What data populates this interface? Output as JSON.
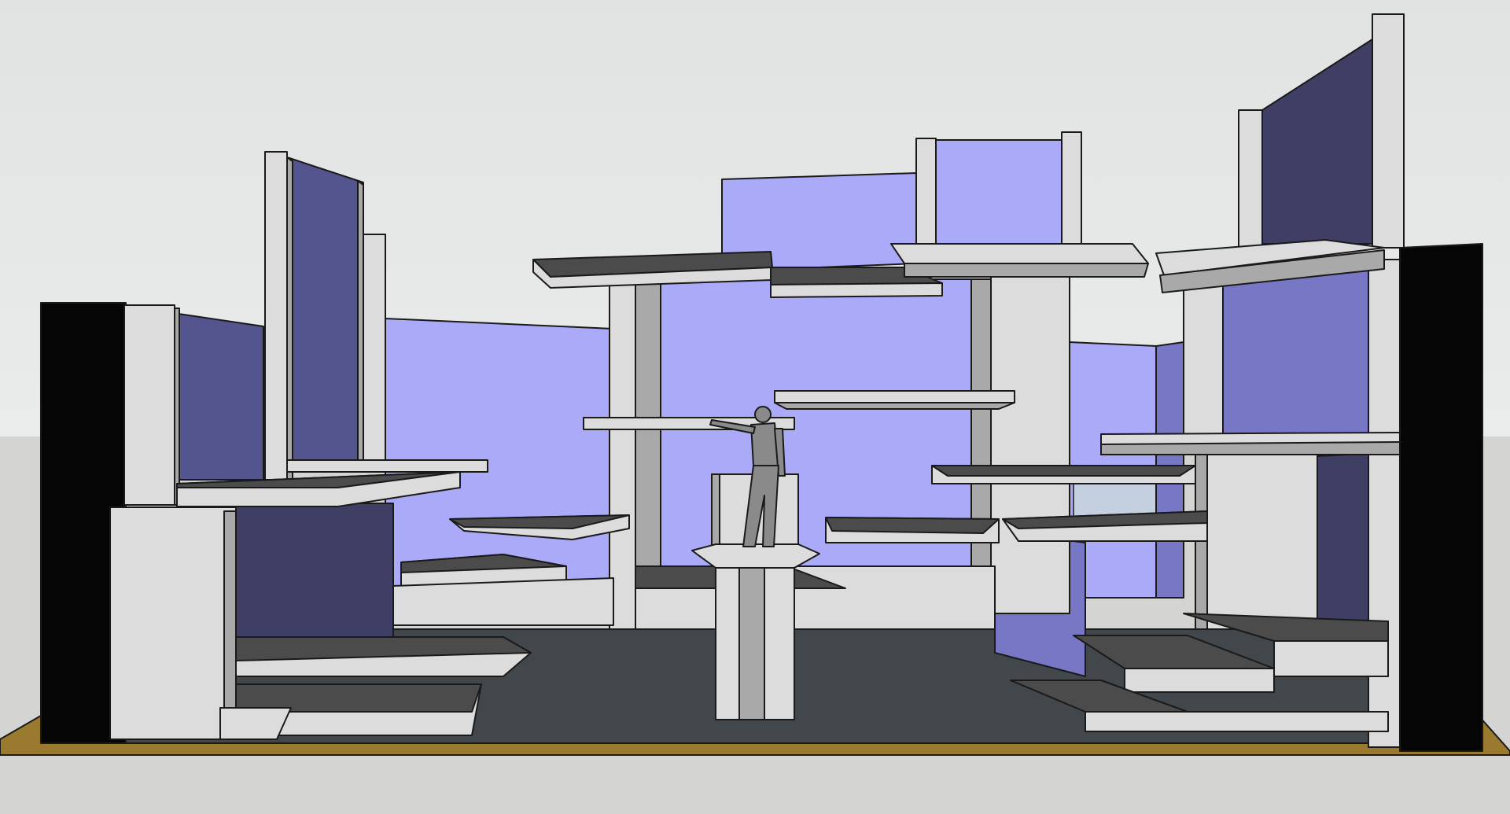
{
  "scene": {
    "kind": "3d-model-render",
    "colors": {
      "sky_top": "#e1e3e3",
      "sky_bottom": "#eaecec",
      "ground": "#d4d5d2",
      "stage_floor": "#42474b",
      "stage_edge": "#9a7a2e",
      "concrete": "#dcdcdc",
      "concrete_shadow": "#a9a9a9",
      "concrete_dark": "#8f8f8f",
      "slab_top": "#4b4b4b",
      "outline": "#1a1a1a",
      "wall_light": "#aaaaf8",
      "wall_mid": "#7777c6",
      "wall_dark": "#54548f",
      "wall_darker": "#3f3f66",
      "wing_black": "#050505",
      "figure": "#8a8a8a"
    }
  }
}
